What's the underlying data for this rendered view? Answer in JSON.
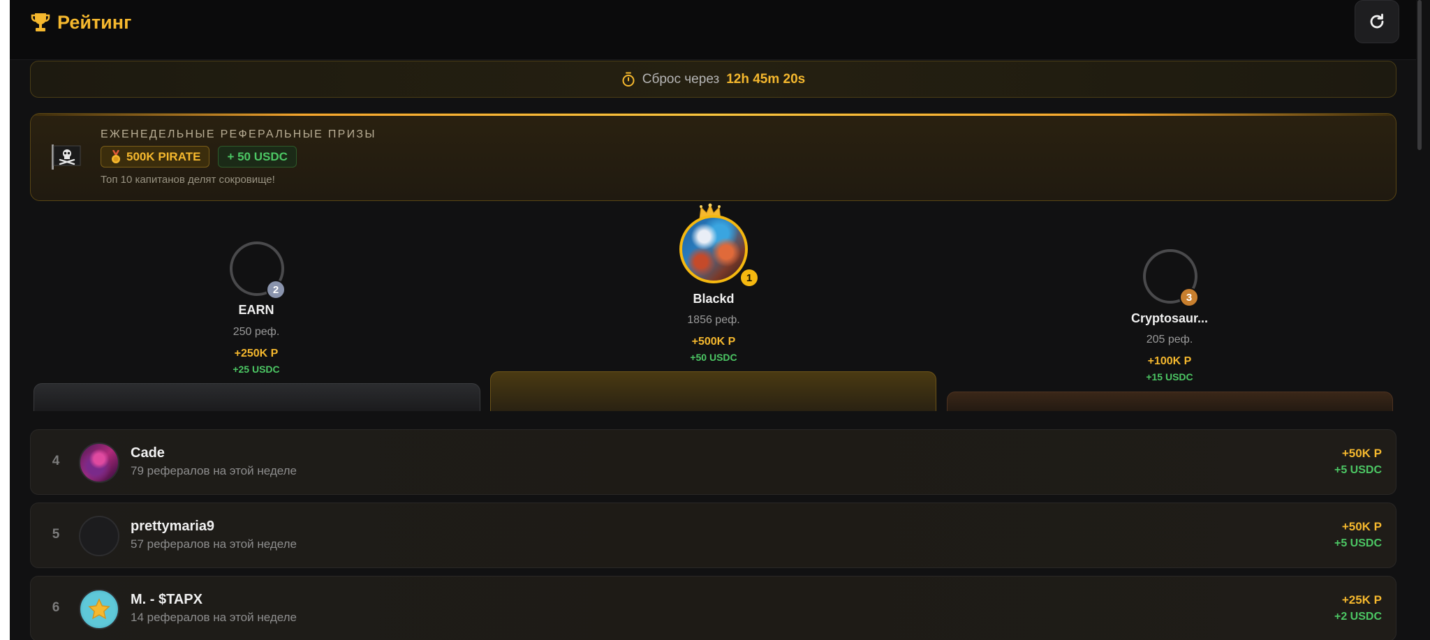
{
  "header": {
    "title": "Рейтинг",
    "trophy_icon": "trophy-icon",
    "refresh_icon": "refresh-icon"
  },
  "timer": {
    "label": "Сброс через",
    "value": "12h 45m 20s",
    "icon": "stopwatch-icon"
  },
  "prize": {
    "heading": "ЕЖЕНЕДЕЛЬНЫЕ РЕФЕРАЛЬНЫЕ ПРИЗЫ",
    "pirate_badge": "500K PIRATE",
    "usdc_badge": "+ 50 USDC",
    "subtitle": "Топ 10 капитанов делят сокровище!",
    "flag_icon": "pirate-flag-icon"
  },
  "podium": [
    {
      "rank": "2",
      "name": "EARN",
      "refs": "250 реф.",
      "pirate": "+250K P",
      "usdc": "+25 USDC"
    },
    {
      "rank": "1",
      "name": "Blackd",
      "refs": "1856 реф.",
      "pirate": "+500K P",
      "usdc": "+50 USDC"
    },
    {
      "rank": "3",
      "name": "Cryptosaur...",
      "refs": "205 реф.",
      "pirate": "+100K P",
      "usdc": "+15 USDC"
    }
  ],
  "list": [
    {
      "rank": "4",
      "name": "Cade",
      "sub": "79 рефералов на этой неделе",
      "pirate": "+50K P",
      "usdc": "+5 USDC"
    },
    {
      "rank": "5",
      "name": "prettymaria9",
      "sub": "57 рефералов на этой неделе",
      "pirate": "+50K P",
      "usdc": "+5 USDC"
    },
    {
      "rank": "6",
      "name": "M. - $TAPX",
      "sub": "14 рефералов на этой неделе",
      "pirate": "+25K P",
      "usdc": "+2 USDC"
    }
  ],
  "colors": {
    "accent": "#f5b82e",
    "green": "#4cc764",
    "background": "#111112",
    "rank_silver": "#8a94ad",
    "rank_gold": "#f5b810",
    "rank_bronze": "#c87f2e"
  }
}
